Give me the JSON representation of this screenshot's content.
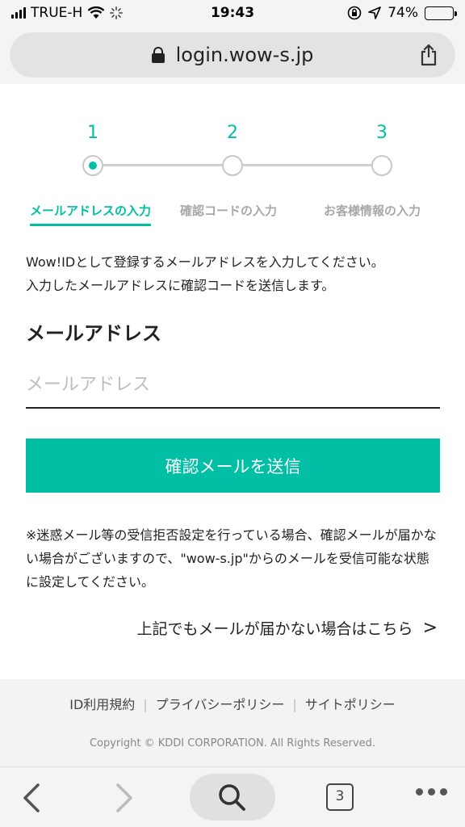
{
  "status_bar": {
    "carrier": "TRUE-H",
    "time": "19:43",
    "battery": "74%"
  },
  "browser": {
    "url": "login.wow-s.jp",
    "open_tabs": "3"
  },
  "stepper": {
    "steps": [
      {
        "number": "1",
        "label": "メールアドレスの入力"
      },
      {
        "number": "2",
        "label": "確認コードの入力"
      },
      {
        "number": "3",
        "label": "お客様情報の入力"
      }
    ],
    "active_step": 1
  },
  "form": {
    "intro_line1": "Wow!IDとして登録するメールアドレスを入力してください。",
    "intro_line2": "入力したメールアドレスに確認コードを送信します。",
    "email_label": "メールアドレス",
    "email_placeholder": "メールアドレス",
    "email_value": "",
    "submit_label": "確認メールを送信",
    "notice": "※迷惑メール等の受信拒否設定を行っている場合、確認メールが届かない場合がございますので、\"wow-s.jp\"からのメールを受信可能な状態に設定してください。",
    "help_link": "上記でもメールが届かない場合はこちら",
    "help_chevron": ">"
  },
  "footer": {
    "links": [
      "ID利用規約",
      "プライバシーポリシー",
      "サイトポリシー"
    ],
    "separator": "|",
    "copyright": "Copyright © KDDI CORPORATION. All Rights Reserved."
  },
  "colors": {
    "accent": "#00bfa5",
    "inactive": "#a8a8a8"
  }
}
